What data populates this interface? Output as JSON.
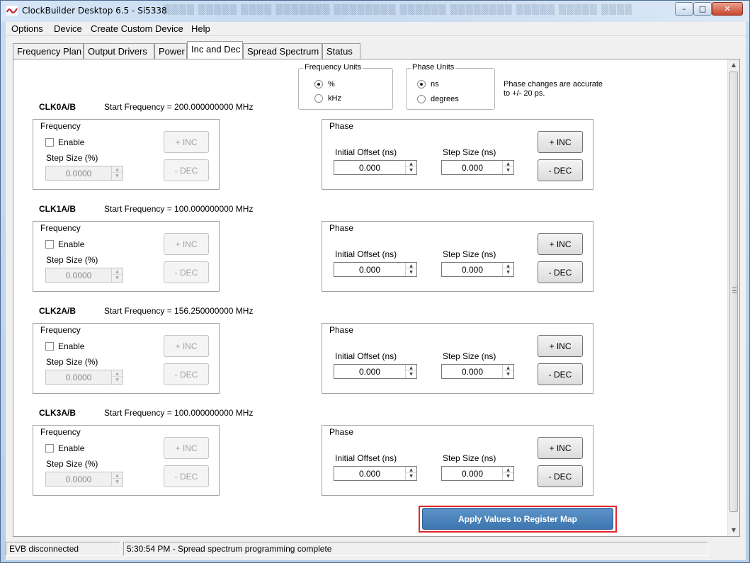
{
  "window": {
    "title": "ClockBuilder Desktop 6.5 - Si5338",
    "buttons": {
      "minimize": "–",
      "maximize": "□",
      "close": "✕"
    }
  },
  "menu": [
    "Options",
    "Device",
    "Create Custom Device",
    "Help"
  ],
  "tabs": [
    {
      "label": "Frequency Plan",
      "active": false
    },
    {
      "label": "Output Drivers",
      "active": false
    },
    {
      "label": "Power",
      "active": false
    },
    {
      "label": "Inc and Dec",
      "active": true
    },
    {
      "label": "Spread Spectrum",
      "active": false
    },
    {
      "label": "Status",
      "active": false
    }
  ],
  "frequency_units": {
    "legend": "Frequency Units",
    "options": [
      {
        "label": "%",
        "selected": true
      },
      {
        "label": "kHz",
        "selected": false
      }
    ]
  },
  "phase_units": {
    "legend": "Phase Units",
    "options": [
      {
        "label": "ns",
        "selected": true
      },
      {
        "label": "degrees",
        "selected": false
      }
    ]
  },
  "phase_note": "Phase changes are accurate to +/- 20 ps.",
  "clocks": [
    {
      "name": "CLK0A/B",
      "start_frequency": "Start Frequency = 200.000000000 MHz",
      "frequency": {
        "title": "Frequency",
        "enable_label": "Enable",
        "step_label": "Step Size (%)",
        "step_value": "0.0000",
        "inc_label": "+  INC",
        "dec_label": "-  DEC"
      },
      "phase": {
        "title": "Phase",
        "initial_label": "Initial Offset (ns)",
        "initial_value": "0.000",
        "step_label": "Step Size (ns)",
        "step_value": "0.000",
        "inc_label": "+  INC",
        "dec_label": "-  DEC"
      }
    },
    {
      "name": "CLK1A/B",
      "start_frequency": "Start Frequency = 100.000000000 MHz",
      "frequency": {
        "title": "Frequency",
        "enable_label": "Enable",
        "step_label": "Step Size (%)",
        "step_value": "0.0000",
        "inc_label": "+  INC",
        "dec_label": "-  DEC"
      },
      "phase": {
        "title": "Phase",
        "initial_label": "Initial Offset (ns)",
        "initial_value": "0.000",
        "step_label": "Step Size (ns)",
        "step_value": "0.000",
        "inc_label": "+  INC",
        "dec_label": "-  DEC"
      }
    },
    {
      "name": "CLK2A/B",
      "start_frequency": "Start Frequency = 156.250000000 MHz",
      "frequency": {
        "title": "Frequency",
        "enable_label": "Enable",
        "step_label": "Step Size (%)",
        "step_value": "0.0000",
        "inc_label": "+  INC",
        "dec_label": "-  DEC"
      },
      "phase": {
        "title": "Phase",
        "initial_label": "Initial Offset (ns)",
        "initial_value": "0.000",
        "step_label": "Step Size (ns)",
        "step_value": "0.000",
        "inc_label": "+  INC",
        "dec_label": "-  DEC"
      }
    },
    {
      "name": "CLK3A/B",
      "start_frequency": "Start Frequency = 100.000000000 MHz",
      "frequency": {
        "title": "Frequency",
        "enable_label": "Enable",
        "step_label": "Step Size (%)",
        "step_value": "0.0000",
        "inc_label": "+  INC",
        "dec_label": "-  DEC"
      },
      "phase": {
        "title": "Phase",
        "initial_label": "Initial Offset (ns)",
        "initial_value": "0.000",
        "step_label": "Step Size (ns)",
        "step_value": "0.000",
        "inc_label": "+  INC",
        "dec_label": "-  DEC"
      }
    }
  ],
  "apply_button": "Apply Values to Register Map",
  "status": {
    "connection": "EVB disconnected",
    "message": "5:30:54 PM - Spread spectrum programming complete"
  },
  "colors": {
    "apply_button": "#3d77b0",
    "highlight_outline": "#e0272b"
  },
  "icons": {
    "app": "signal-wave-icon",
    "scroll_up": "chevron-up-icon",
    "scroll_down": "chevron-down-icon"
  }
}
